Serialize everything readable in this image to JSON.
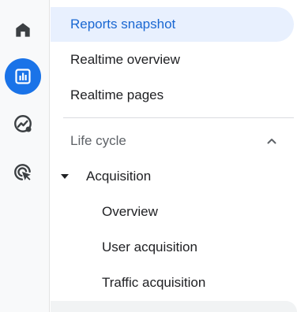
{
  "rail": {
    "items": [
      {
        "icon": "home-icon",
        "active": false
      },
      {
        "icon": "reports-icon",
        "active": true
      },
      {
        "icon": "explore-icon",
        "active": false
      },
      {
        "icon": "advertising-icon",
        "active": false
      }
    ]
  },
  "nav": {
    "top_items": [
      {
        "label": "Reports snapshot",
        "active": true
      },
      {
        "label": "Realtime overview",
        "active": false
      },
      {
        "label": "Realtime pages",
        "active": false
      }
    ],
    "section": {
      "label": "Life cycle",
      "expanded": true
    },
    "group": {
      "label": "Acquisition",
      "expanded": true,
      "items": [
        {
          "label": "Overview"
        },
        {
          "label": "User acquisition"
        },
        {
          "label": "Traffic acquisition"
        }
      ]
    }
  },
  "colors": {
    "accent": "#1a73e8",
    "active_bg": "#e8f0fe",
    "active_text": "#1967d2",
    "text": "#202124",
    "muted": "#5f6368"
  }
}
